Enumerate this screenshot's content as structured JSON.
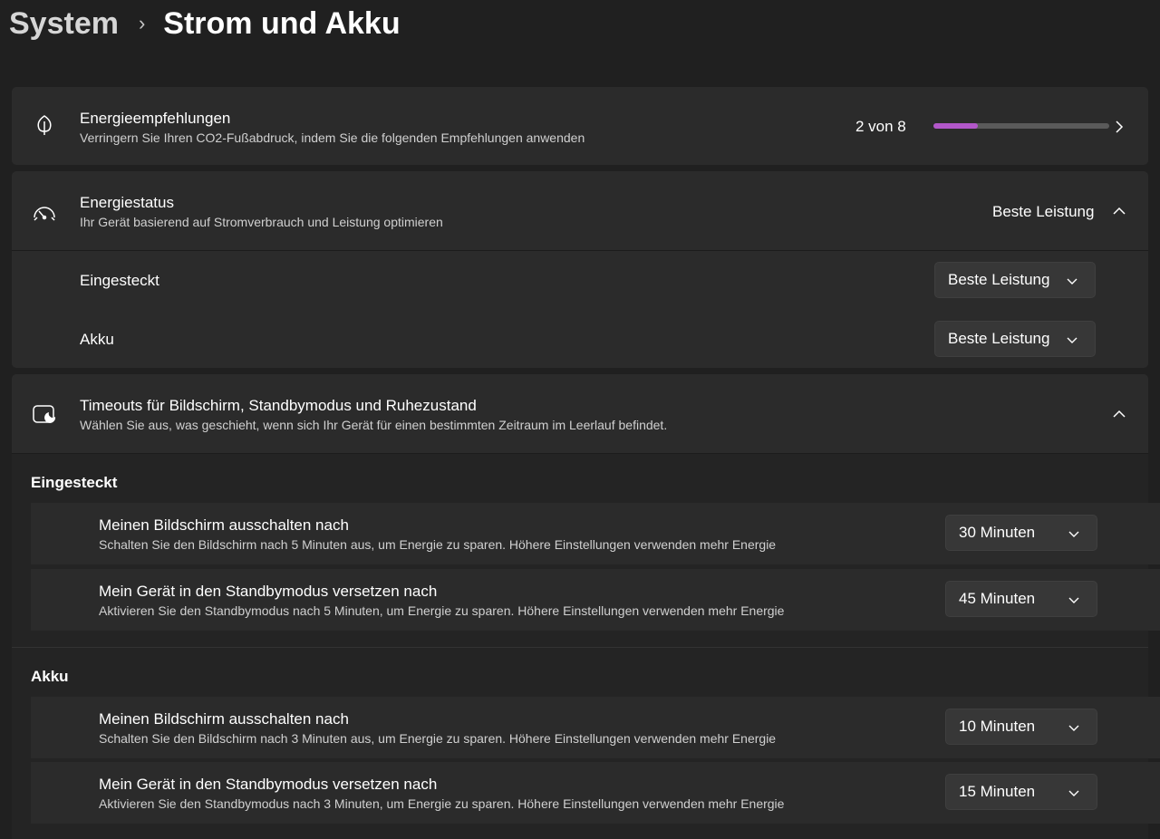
{
  "breadcrumb": {
    "parent": "System",
    "separator": "›",
    "current": "Strom und Akku"
  },
  "energy_recommendations": {
    "icon": "leaf-icon",
    "title": "Energieempfehlungen",
    "subtitle": "Verringern Sie Ihren CO2-Fußabdruck, indem Sie die folgenden Empfehlungen anwenden",
    "progress_text": "2 von 8",
    "progress_value": 0.25,
    "accent_color": "#b257c9"
  },
  "power_mode": {
    "icon": "gauge-icon",
    "title": "Energiestatus",
    "subtitle": "Ihr Gerät basierend auf Stromverbrauch und Leistung optimieren",
    "current_value": "Beste Leistung",
    "rows": [
      {
        "label": "Eingesteckt",
        "value": "Beste Leistung"
      },
      {
        "label": "Akku",
        "value": "Beste Leistung"
      }
    ]
  },
  "timeouts": {
    "icon": "screen-sleep-icon",
    "title": "Timeouts für Bildschirm, Standbymodus und Ruhezustand",
    "subtitle": "Wählen Sie aus, was geschieht, wenn sich Ihr Gerät für einen bestimmten Zeitraum im Leerlauf befindet.",
    "groups": [
      {
        "label": "Eingesteckt",
        "items": [
          {
            "title": "Meinen Bildschirm ausschalten nach",
            "subtitle": "Schalten Sie den Bildschirm nach 5 Minuten aus, um Energie zu sparen. Höhere Einstellungen verwenden mehr Energie",
            "value": "30 Minuten"
          },
          {
            "title": "Mein Gerät in den Standbymodus versetzen nach",
            "subtitle": "Aktivieren Sie den Standbymodus nach 5 Minuten, um Energie zu sparen. Höhere Einstellungen verwenden mehr Energie",
            "value": "45 Minuten"
          }
        ]
      },
      {
        "label": "Akku",
        "items": [
          {
            "title": "Meinen Bildschirm ausschalten nach",
            "subtitle": "Schalten Sie den Bildschirm nach 3 Minuten aus, um Energie zu sparen. Höhere Einstellungen verwenden mehr Energie",
            "value": "10 Minuten"
          },
          {
            "title": "Mein Gerät in den Standbymodus versetzen nach",
            "subtitle": "Aktivieren Sie den Standbymodus nach 3 Minuten, um Energie zu sparen. Höhere Einstellungen verwenden mehr Energie",
            "value": "15 Minuten"
          }
        ]
      }
    ]
  }
}
